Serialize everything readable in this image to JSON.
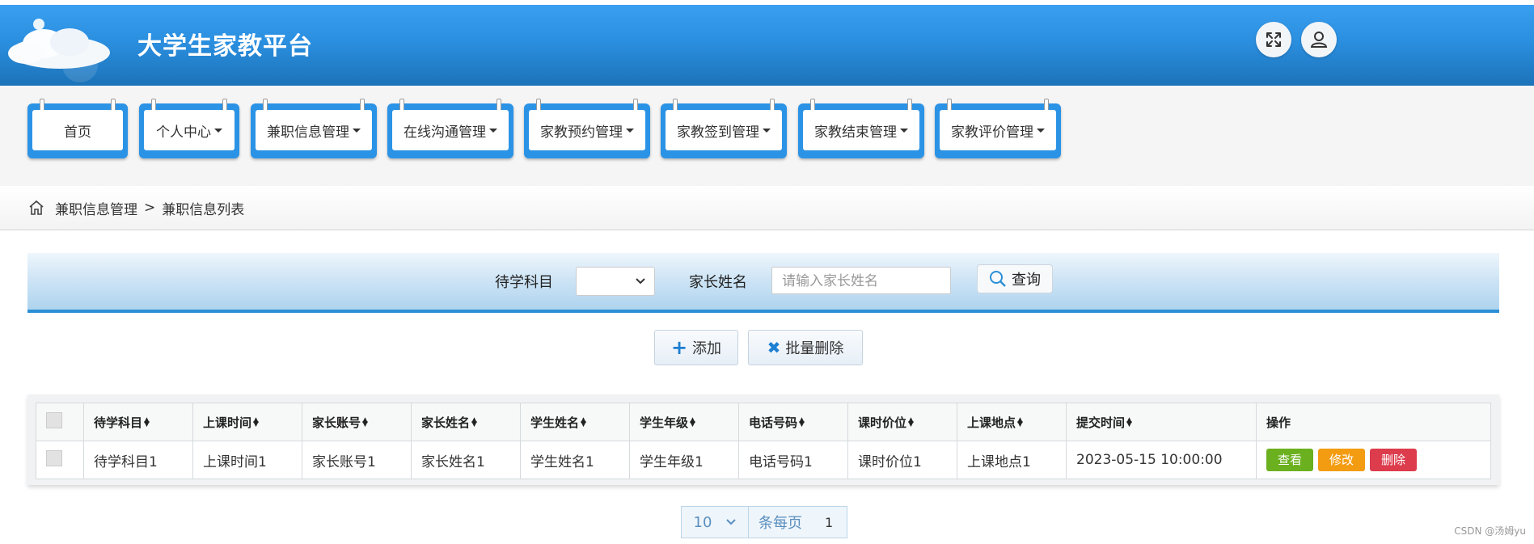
{
  "header": {
    "title": "大学生家教平台"
  },
  "nav": {
    "items": [
      {
        "label": "首页",
        "dropdown": false
      },
      {
        "label": "个人中心",
        "dropdown": true
      },
      {
        "label": "兼职信息管理",
        "dropdown": true
      },
      {
        "label": "在线沟通管理",
        "dropdown": true
      },
      {
        "label": "家教预约管理",
        "dropdown": true
      },
      {
        "label": "家教签到管理",
        "dropdown": true
      },
      {
        "label": "家教结束管理",
        "dropdown": true
      },
      {
        "label": "家教评价管理",
        "dropdown": true
      }
    ]
  },
  "breadcrumb": {
    "parent": "兼职信息管理",
    "separator": ">",
    "current": "兼职信息列表"
  },
  "search": {
    "subject_label": "待学科目",
    "subject_value": "",
    "parent_name_label": "家长姓名",
    "parent_name_placeholder": "请输入家长姓名",
    "search_button": "查询"
  },
  "actions": {
    "add": "添加",
    "batch_delete": "批量删除"
  },
  "table": {
    "columns": [
      "待学科目",
      "上课时间",
      "家长账号",
      "家长姓名",
      "学生姓名",
      "学生年级",
      "电话号码",
      "课时价位",
      "上课地点",
      "提交时间"
    ],
    "ops_header": "操作",
    "rows": [
      [
        "待学科目1",
        "上课时间1",
        "家长账号1",
        "家长姓名1",
        "学生姓名1",
        "学生年级1",
        "电话号码1",
        "课时价位1",
        "上课地点1",
        "2023-05-15 10:00:00"
      ]
    ],
    "row_buttons": {
      "view": "查看",
      "edit": "修改",
      "delete": "删除"
    }
  },
  "pager": {
    "page_size": "10",
    "per_page_label": "条每页",
    "current_page": "1"
  },
  "watermark": "CSDN @汤姆yu",
  "colors": {
    "header_blue": "#2b8fe0",
    "view": "#6bb01f",
    "edit": "#f39c12",
    "delete": "#dc3c4c"
  }
}
